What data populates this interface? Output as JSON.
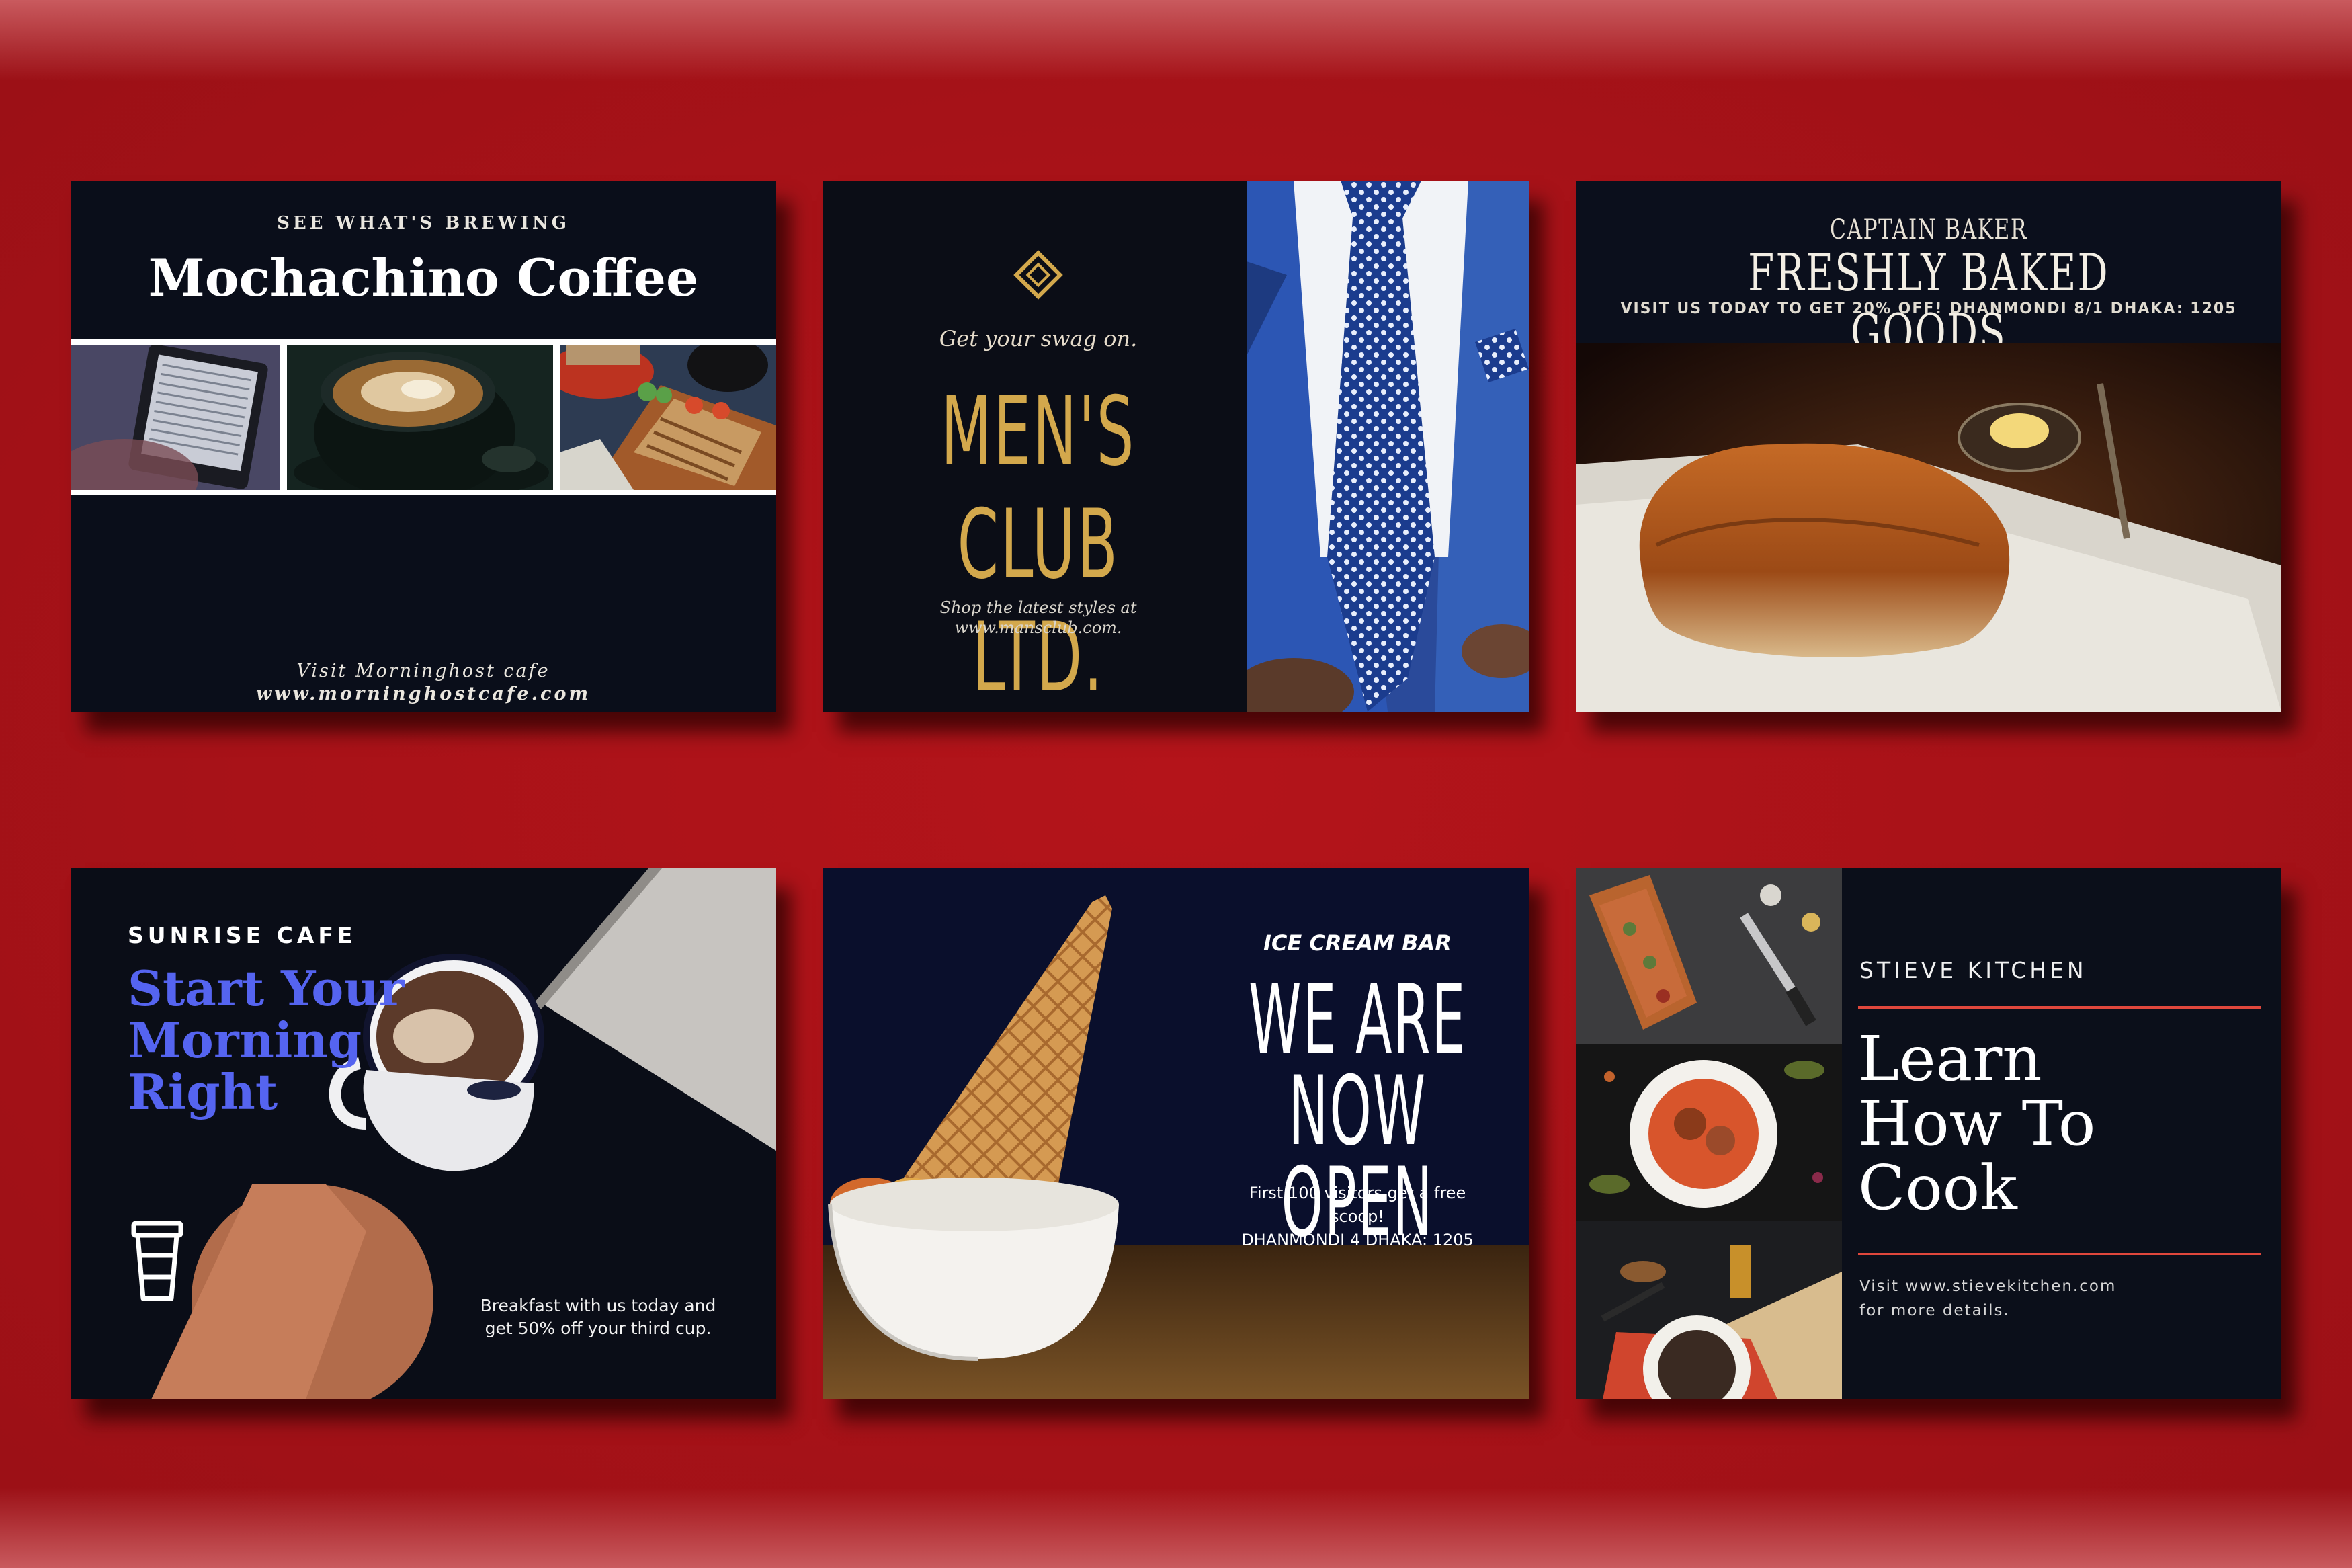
{
  "cards": {
    "coffee": {
      "kicker": "SEE WHAT'S BREWING",
      "title": "Mochachino Coffee",
      "footer_line1": "Visit Morninghost cafe",
      "footer_line2": "www.morninghostcafe.com"
    },
    "mens_club": {
      "tagline": "Get your swag on.",
      "headline_line1": "MEN'S CLUB",
      "headline_line2": "LTD.",
      "shop_line1": "Shop the latest styles at",
      "shop_line2": "www.mansclub.com."
    },
    "baker": {
      "kicker": "CAPTAIN BAKER",
      "title": "FRESHLY BAKED GOODS",
      "subtitle": "VISIT US TODAY TO GET 20% OFF!  DHANMONDI 8/1 DHAKA: 1205"
    },
    "sunrise": {
      "brand": "SUNRISE CAFE",
      "headline": "Start Your Morning Right",
      "body_line1": "Breakfast with us today and",
      "body_line2": "get 50% off your third cup.",
      "icon": "coffee-cup-icon"
    },
    "ice_cream": {
      "kicker": "ICE CREAM BAR",
      "headline_line1": "WE ARE",
      "headline_line2": "NOW OPEN",
      "body_line1": "First 100 visitors get a free",
      "body_line2": "scoop!",
      "body_line3": "DHANMONDI 4 DHAKA: 1205"
    },
    "kitchen": {
      "brand": "STIEVE KITCHEN",
      "headline_line1": "Learn",
      "headline_line2": "How To",
      "headline_line3": "Cook",
      "footer_line1": "Visit www.stievekitchen.com",
      "footer_line2": "for more details."
    }
  },
  "colors": {
    "background": "#b4141a",
    "card_bg": "#0a0e1a",
    "gold": "#d3a84c",
    "blue_headline": "#5564f0",
    "accent_rule": "#e0473c"
  }
}
